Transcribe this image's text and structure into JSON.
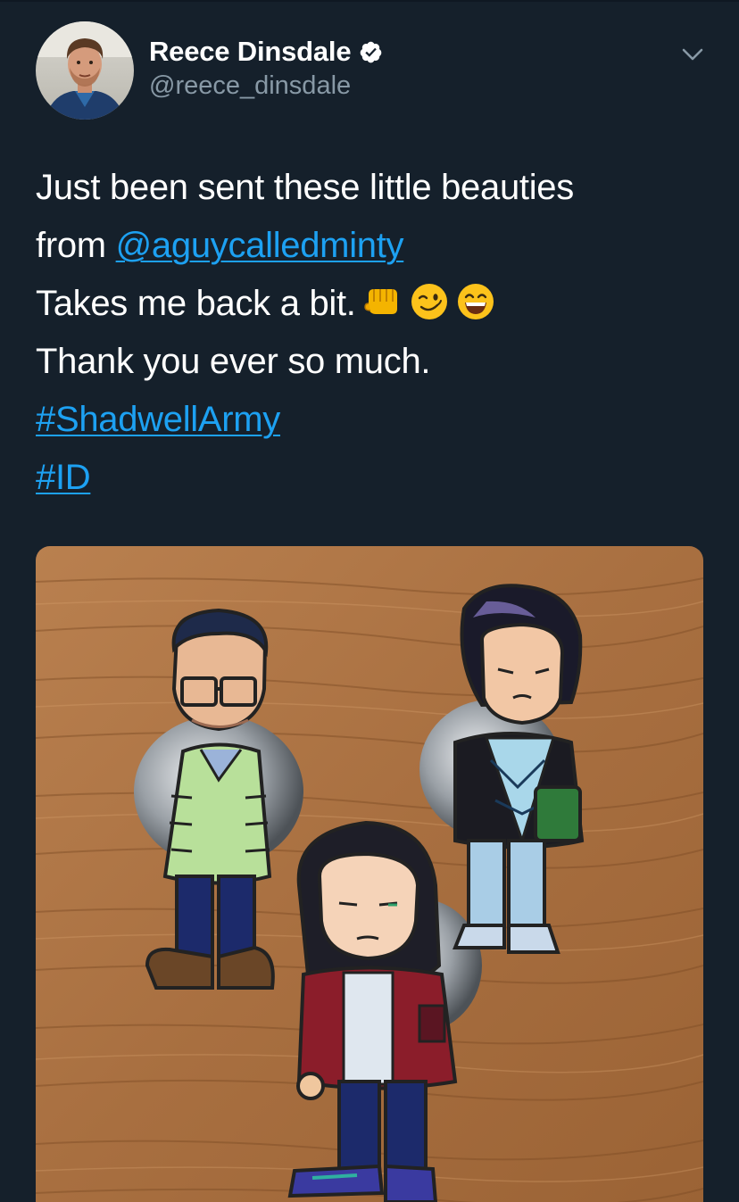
{
  "tweet": {
    "author": {
      "display_name": "Reece Dinsdale",
      "handle": "@reece_dinsdale",
      "verified": true,
      "avatar_icon": "author-avatar"
    },
    "text": {
      "line1": "Just been sent these little beauties",
      "line2_prefix": "from ",
      "mention": "@aguycalledminty",
      "line3": "Takes me back a bit.",
      "line3_emojis": [
        "oncoming-fist-emoji",
        "winking-face-emoji",
        "grinning-face-emoji"
      ],
      "line4": "Thank you ever so much.",
      "hashtag1": "#ShadwellArmy",
      "hashtag2": "#ID"
    },
    "menu_icon": "chevron-down-icon",
    "media": {
      "description_icon": "enamel-pins-photo"
    }
  },
  "colors": {
    "background": "#15202b",
    "link": "#1da1f2",
    "secondary_text": "#8899a6",
    "primary_text": "#ffffff",
    "verified_badge": "#ffffff"
  }
}
